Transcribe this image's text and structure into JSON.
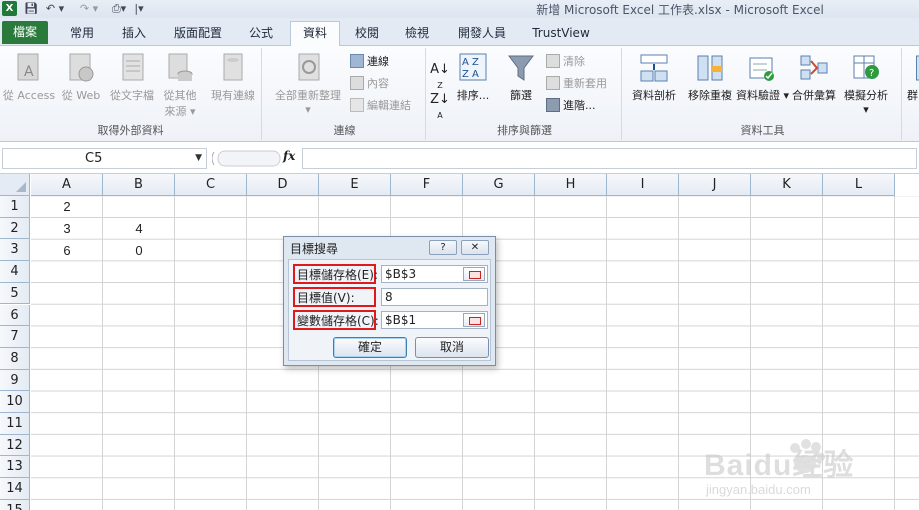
{
  "window": {
    "title": "新增 Microsoft Excel 工作表.xlsx - Microsoft Excel",
    "app_icon": "X"
  },
  "tabs": [
    {
      "label": "檔案",
      "kind": "file"
    },
    {
      "label": "常用"
    },
    {
      "label": "插入"
    },
    {
      "label": "版面配置"
    },
    {
      "label": "公式"
    },
    {
      "label": "資料",
      "active": true
    },
    {
      "label": "校閱"
    },
    {
      "label": "檢視"
    },
    {
      "label": "開發人員"
    },
    {
      "label": "TrustView"
    }
  ],
  "ribbon": {
    "groups": {
      "external": {
        "label": "取得外部資料",
        "from_access": "從 Access",
        "from_web": "從 Web",
        "from_text": "從文字檔",
        "from_other_1": "從其他",
        "from_other_2": "來源",
        "existing": "現有連線"
      },
      "connections": {
        "label": "連線",
        "refresh_all": "全部重新整理",
        "connections": "連線",
        "properties": "內容",
        "edit_links": "編輯連結"
      },
      "sort_filter": {
        "label": "排序與篩選",
        "sort": "排序...",
        "filter": "篩選",
        "clear": "清除",
        "reapply": "重新套用",
        "advanced": "進階..."
      },
      "tools": {
        "label": "資料工具",
        "text_to_columns": "資料剖析",
        "remove_duplicates": "移除重複",
        "data_validation": "資料驗證",
        "consolidate": "合併彙算",
        "what_if": "模擬分析",
        "overflow": "群"
      }
    }
  },
  "formula_bar": {
    "name_box": "C5",
    "fx": "fx",
    "formula": ""
  },
  "sheet": {
    "columns": [
      "A",
      "B",
      "C",
      "D",
      "E",
      "F",
      "G",
      "H",
      "I",
      "J",
      "K",
      "L"
    ],
    "rows": [
      "1",
      "2",
      "3",
      "4",
      "5",
      "6",
      "7",
      "8",
      "9",
      "10",
      "11",
      "12",
      "13",
      "14",
      "15"
    ],
    "cells": {
      "A1": "2",
      "A2": "3",
      "B2": "4",
      "A3": "6",
      "B3": "0"
    }
  },
  "dialog": {
    "title": "目標搜尋",
    "help": "?",
    "close": "✕",
    "set_cell_label": "目標儲存格(E):",
    "set_cell_value": "$B$3",
    "to_value_label": "目標值(V):",
    "to_value_value": "8",
    "changing_cell_label": "變數儲存格(C):",
    "changing_cell_value": "$B$1",
    "ok": "確定",
    "cancel": "取消"
  },
  "watermark": {
    "brand": "Baidu经验",
    "url": "jingyan.baidu.com"
  }
}
